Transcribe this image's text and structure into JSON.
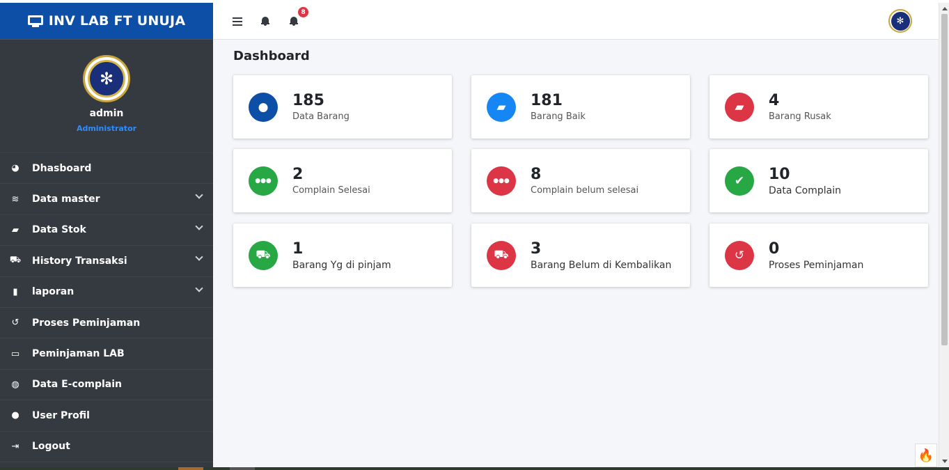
{
  "brand": {
    "title": "INV LAB FT UNUJA",
    "color": "#0d4ea6"
  },
  "user": {
    "name": "admin",
    "role": "Administrator"
  },
  "sidebar": {
    "items": [
      {
        "label": "Dhasboard",
        "icon": "tachometer-icon",
        "glyph": "◕",
        "expandable": false
      },
      {
        "label": "Data master",
        "icon": "database-icon",
        "glyph": "≋",
        "expandable": true
      },
      {
        "label": "Data Stok",
        "icon": "briefcase-icon",
        "glyph": "▰",
        "expandable": true
      },
      {
        "label": "History Transaksi",
        "icon": "cart-icon",
        "glyph": "⛟",
        "expandable": true
      },
      {
        "label": "laporan",
        "icon": "file-icon",
        "glyph": "▮",
        "expandable": true
      },
      {
        "label": "Proses Peminjaman",
        "icon": "history-icon",
        "glyph": "↺",
        "expandable": false
      },
      {
        "label": "Peminjaman LAB",
        "icon": "desktop-icon",
        "glyph": "▭",
        "expandable": false
      },
      {
        "label": "Data E-complain",
        "icon": "comments-icon",
        "glyph": "◍",
        "expandable": false
      },
      {
        "label": "User Profil",
        "icon": "user-icon",
        "glyph": "●",
        "expandable": false
      },
      {
        "label": "Logout",
        "icon": "sign-out-icon",
        "glyph": "⇥",
        "expandable": false
      }
    ]
  },
  "navbar": {
    "notification_count": "8"
  },
  "page": {
    "title": "Dashboard"
  },
  "cards": [
    {
      "value": "185",
      "label": "Data Barang",
      "icon": "user-icon",
      "glyph": "●",
      "color": "#0d4ea6"
    },
    {
      "value": "181",
      "label": "Barang Baik",
      "icon": "briefcase-icon",
      "glyph": "▰",
      "color": "#1786f5"
    },
    {
      "value": "4",
      "label": "Barang Rusak",
      "icon": "briefcase-icon",
      "glyph": "▰",
      "color": "#dc3545"
    },
    {
      "value": "2",
      "label": "Complain Selesai",
      "icon": "users-icon",
      "glyph": "●●●",
      "color": "#28a745"
    },
    {
      "value": "8",
      "label": "Complain belum selesai",
      "icon": "users-icon",
      "glyph": "●●●",
      "color": "#dc3545"
    },
    {
      "value": "10",
      "label": "Data Complain",
      "icon": "check-icon",
      "glyph": "✔",
      "color": "#28a745"
    },
    {
      "value": "1",
      "label": "Barang Yg di pinjam",
      "icon": "cart-icon",
      "glyph": "⛟",
      "color": "#28a745"
    },
    {
      "value": "3",
      "label": "Barang Belum di Kembalikan",
      "icon": "cart-icon",
      "glyph": "⛟",
      "color": "#dc3545"
    },
    {
      "value": "0",
      "label": "Proses Peminjaman",
      "icon": "history-icon",
      "glyph": "↺",
      "color": "#dc3545"
    }
  ]
}
